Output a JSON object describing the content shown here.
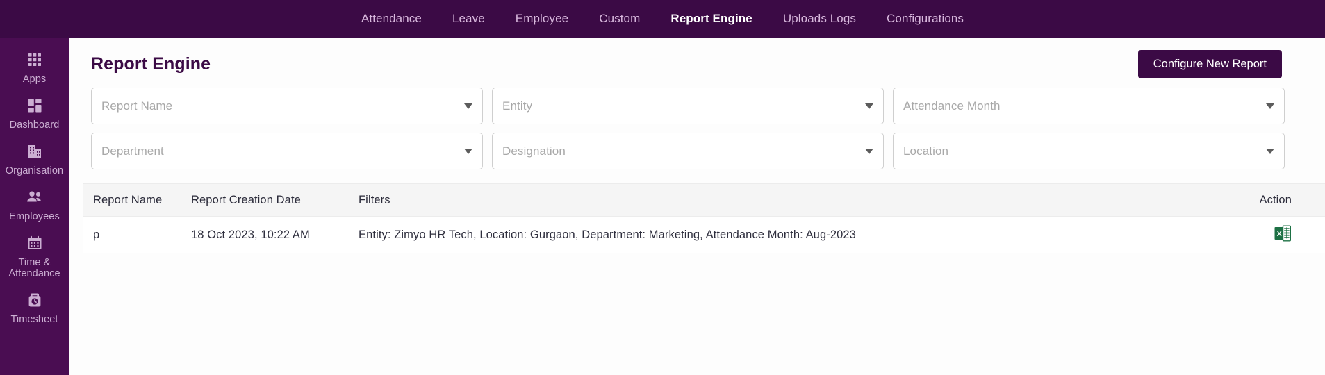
{
  "topnav": {
    "items": [
      {
        "label": "Attendance",
        "active": false
      },
      {
        "label": "Leave",
        "active": false
      },
      {
        "label": "Employee",
        "active": false
      },
      {
        "label": "Custom",
        "active": false
      },
      {
        "label": "Report Engine",
        "active": true
      },
      {
        "label": "Uploads Logs",
        "active": false
      },
      {
        "label": "Configurations",
        "active": false
      }
    ]
  },
  "sidebar": {
    "items": [
      {
        "label": "Apps",
        "icon": "grid-apps-icon"
      },
      {
        "label": "Dashboard",
        "icon": "dashboard-icon"
      },
      {
        "label": "Organisation",
        "icon": "building-icon"
      },
      {
        "label": "Employees",
        "icon": "people-icon"
      },
      {
        "label": "Time & Attendance",
        "icon": "calendar-icon"
      },
      {
        "label": "Timesheet",
        "icon": "timesheet-clock-icon"
      }
    ]
  },
  "header": {
    "title": "Report Engine",
    "configure_button": "Configure New Report"
  },
  "filters": {
    "row1": [
      {
        "placeholder": "Report Name",
        "value": ""
      },
      {
        "placeholder": "Entity",
        "value": ""
      },
      {
        "placeholder": "Attendance Month",
        "value": ""
      }
    ],
    "row2": [
      {
        "placeholder": "Department",
        "value": ""
      },
      {
        "placeholder": "Designation",
        "value": ""
      },
      {
        "placeholder": "Location",
        "value": ""
      }
    ]
  },
  "table": {
    "columns": [
      "Report Name",
      "Report Creation Date",
      "Filters",
      "Action"
    ],
    "rows": [
      {
        "report_name": "p",
        "creation_date": "18 Oct 2023, 10:22 AM",
        "filters": "Entity: Zimyo HR Tech, Location: Gurgaon, Department: Marketing, Attendance Month: Aug-2023",
        "action_icon": "excel-download-icon"
      }
    ]
  },
  "colors": {
    "topbar": "#3b0a45",
    "sidebar": "#4a0d52",
    "accent": "#3b0a45",
    "excel_green": "#1d7044"
  }
}
